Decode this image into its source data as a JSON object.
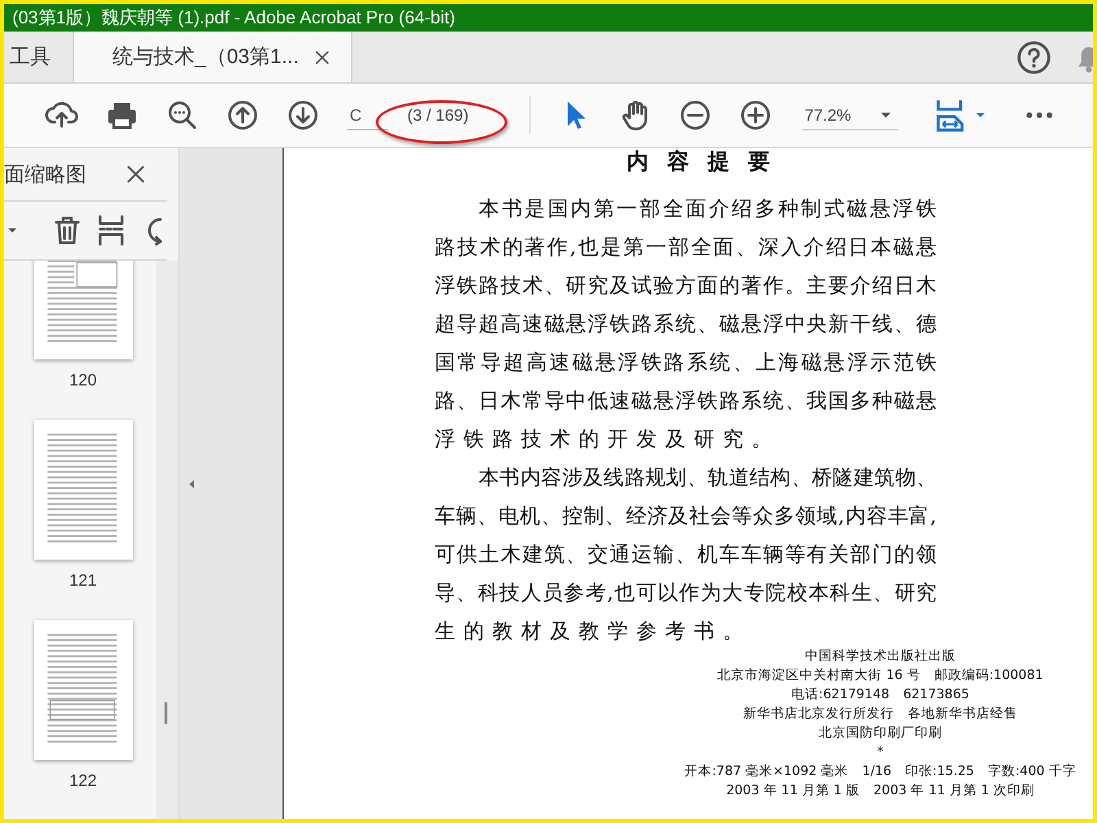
{
  "window": {
    "title": "(03第1版）魏庆朝等 (1).pdf - Adobe Acrobat Pro (64-bit)"
  },
  "tabs": [
    {
      "label": "工具",
      "selected": false
    },
    {
      "label": "统与技术_（03第1...",
      "selected": true
    }
  ],
  "toolbar": {
    "page_field": {
      "value": "C"
    },
    "page_count": "(3 / 169)",
    "zoom": {
      "value": "77.2%"
    }
  },
  "thumbnail_panel": {
    "title": "面缩略图",
    "thumbnails": [
      {
        "label": "120"
      },
      {
        "label": "121"
      },
      {
        "label": "122"
      }
    ]
  },
  "document": {
    "heading": "内 容 提 要",
    "paragraphs": [
      [
        "本书是国内第一部全面介绍多种制式磁悬浮铁",
        "路技术的著作,也是第一部全面、深入介绍日本磁悬",
        "浮铁路技术、研究及试验方面的著作。主要介绍日木",
        "超导超高速磁悬浮铁路系统、磁悬浮中央新干线、德",
        "国常导超高速磁悬浮铁路系统、上海磁悬浮示范铁",
        "路、日木常导中低速磁悬浮铁路系统、我国多种磁悬",
        "浮铁路技术的开发及研究。"
      ],
      [
        "本书内容涉及线路规划、轨道结构、桥隧建筑物、",
        "车辆、电机、控制、经济及社会等众多领域,内容丰富,",
        "可供土木建筑、交通运输、机车车辆等有关部门的领",
        "导、科技人员参考,也可以作为大专院校本科生、研究",
        "生的教材及教学参考书。"
      ]
    ],
    "imprint": [
      "中国科学技术出版社出版",
      "北京市海淀区中关村南大街 16 号　邮政编码:100081",
      "电话:62179148　62173865",
      "新华书店北京发行所发行　各地新华书店经售",
      "北京国防印刷厂印刷",
      "*",
      "开本:787 毫米×1092 毫米　1/16　印张:15.25　字数:400 千字",
      "2003 年 11 月第 1 版　2003 年 11 月第 1 次印刷"
    ]
  }
}
